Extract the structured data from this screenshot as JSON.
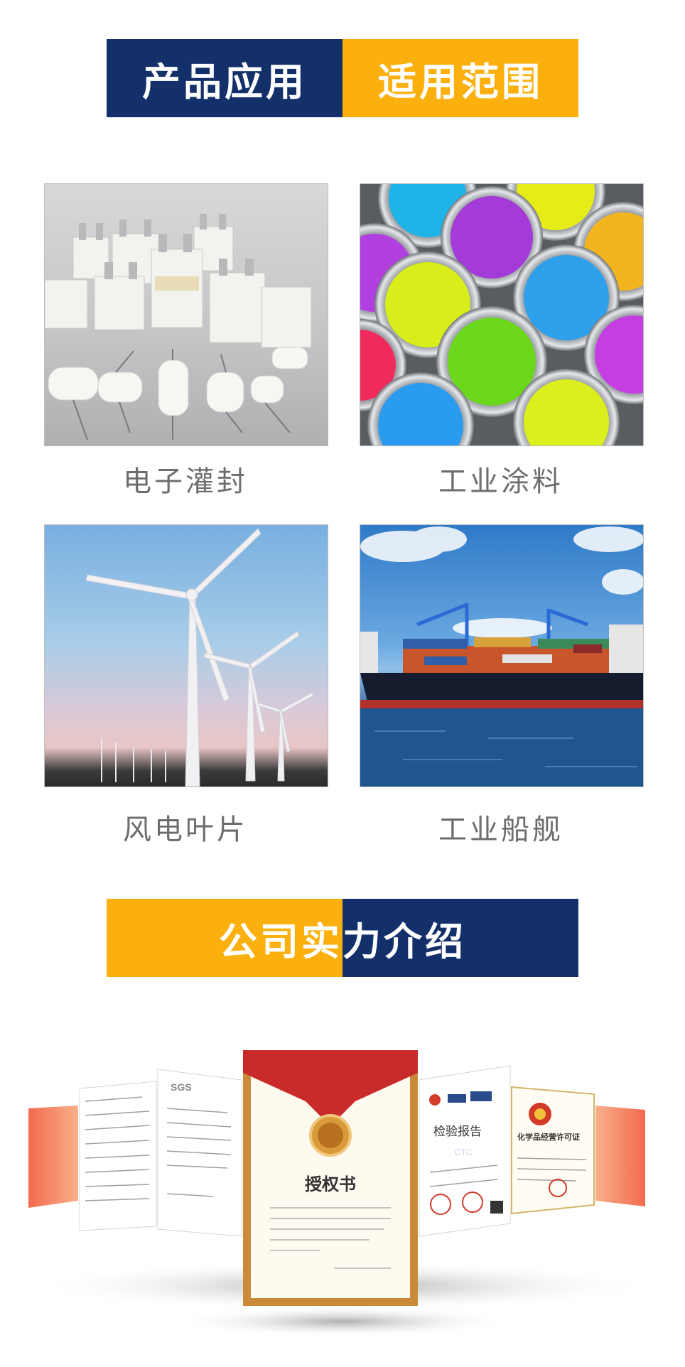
{
  "section1": {
    "title_left": "产品应用",
    "title_right": "适用范围"
  },
  "applications": [
    {
      "label": "电子灌封",
      "icon": "capacitor-photo"
    },
    {
      "label": "工业涂料",
      "icon": "paint-cans-photo"
    },
    {
      "label": "风电叶片",
      "icon": "wind-turbine-photo"
    },
    {
      "label": "工业船舰",
      "icon": "cargo-ship-photo"
    }
  ],
  "section2": {
    "title_left": "公司实",
    "title_right": "力介绍"
  },
  "certificates": {
    "center_title": "授权书",
    "left_brand": "SGS",
    "right_title": "检验报告",
    "right_partial_title": "化学品经营许可证",
    "right_watermark": "CTC"
  },
  "colors": {
    "navy": "#13306a",
    "gold": "#fbb00e",
    "caption": "#6d6d6d"
  }
}
